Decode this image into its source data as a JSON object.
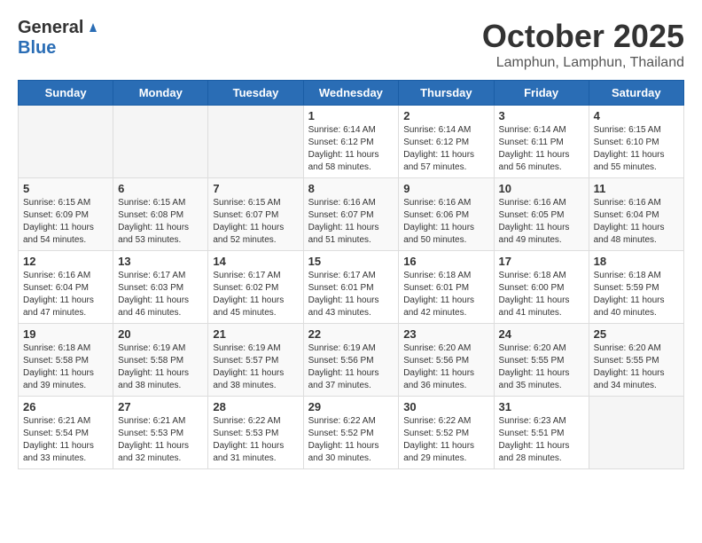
{
  "header": {
    "logo_general": "General",
    "logo_blue": "Blue",
    "month": "October 2025",
    "location": "Lamphun, Lamphun, Thailand"
  },
  "weekdays": [
    "Sunday",
    "Monday",
    "Tuesday",
    "Wednesday",
    "Thursday",
    "Friday",
    "Saturday"
  ],
  "weeks": [
    [
      {
        "day": "",
        "info": ""
      },
      {
        "day": "",
        "info": ""
      },
      {
        "day": "",
        "info": ""
      },
      {
        "day": "1",
        "info": "Sunrise: 6:14 AM\nSunset: 6:12 PM\nDaylight: 11 hours\nand 58 minutes."
      },
      {
        "day": "2",
        "info": "Sunrise: 6:14 AM\nSunset: 6:12 PM\nDaylight: 11 hours\nand 57 minutes."
      },
      {
        "day": "3",
        "info": "Sunrise: 6:14 AM\nSunset: 6:11 PM\nDaylight: 11 hours\nand 56 minutes."
      },
      {
        "day": "4",
        "info": "Sunrise: 6:15 AM\nSunset: 6:10 PM\nDaylight: 11 hours\nand 55 minutes."
      }
    ],
    [
      {
        "day": "5",
        "info": "Sunrise: 6:15 AM\nSunset: 6:09 PM\nDaylight: 11 hours\nand 54 minutes."
      },
      {
        "day": "6",
        "info": "Sunrise: 6:15 AM\nSunset: 6:08 PM\nDaylight: 11 hours\nand 53 minutes."
      },
      {
        "day": "7",
        "info": "Sunrise: 6:15 AM\nSunset: 6:07 PM\nDaylight: 11 hours\nand 52 minutes."
      },
      {
        "day": "8",
        "info": "Sunrise: 6:16 AM\nSunset: 6:07 PM\nDaylight: 11 hours\nand 51 minutes."
      },
      {
        "day": "9",
        "info": "Sunrise: 6:16 AM\nSunset: 6:06 PM\nDaylight: 11 hours\nand 50 minutes."
      },
      {
        "day": "10",
        "info": "Sunrise: 6:16 AM\nSunset: 6:05 PM\nDaylight: 11 hours\nand 49 minutes."
      },
      {
        "day": "11",
        "info": "Sunrise: 6:16 AM\nSunset: 6:04 PM\nDaylight: 11 hours\nand 48 minutes."
      }
    ],
    [
      {
        "day": "12",
        "info": "Sunrise: 6:16 AM\nSunset: 6:04 PM\nDaylight: 11 hours\nand 47 minutes."
      },
      {
        "day": "13",
        "info": "Sunrise: 6:17 AM\nSunset: 6:03 PM\nDaylight: 11 hours\nand 46 minutes."
      },
      {
        "day": "14",
        "info": "Sunrise: 6:17 AM\nSunset: 6:02 PM\nDaylight: 11 hours\nand 45 minutes."
      },
      {
        "day": "15",
        "info": "Sunrise: 6:17 AM\nSunset: 6:01 PM\nDaylight: 11 hours\nand 43 minutes."
      },
      {
        "day": "16",
        "info": "Sunrise: 6:18 AM\nSunset: 6:01 PM\nDaylight: 11 hours\nand 42 minutes."
      },
      {
        "day": "17",
        "info": "Sunrise: 6:18 AM\nSunset: 6:00 PM\nDaylight: 11 hours\nand 41 minutes."
      },
      {
        "day": "18",
        "info": "Sunrise: 6:18 AM\nSunset: 5:59 PM\nDaylight: 11 hours\nand 40 minutes."
      }
    ],
    [
      {
        "day": "19",
        "info": "Sunrise: 6:18 AM\nSunset: 5:58 PM\nDaylight: 11 hours\nand 39 minutes."
      },
      {
        "day": "20",
        "info": "Sunrise: 6:19 AM\nSunset: 5:58 PM\nDaylight: 11 hours\nand 38 minutes."
      },
      {
        "day": "21",
        "info": "Sunrise: 6:19 AM\nSunset: 5:57 PM\nDaylight: 11 hours\nand 38 minutes."
      },
      {
        "day": "22",
        "info": "Sunrise: 6:19 AM\nSunset: 5:56 PM\nDaylight: 11 hours\nand 37 minutes."
      },
      {
        "day": "23",
        "info": "Sunrise: 6:20 AM\nSunset: 5:56 PM\nDaylight: 11 hours\nand 36 minutes."
      },
      {
        "day": "24",
        "info": "Sunrise: 6:20 AM\nSunset: 5:55 PM\nDaylight: 11 hours\nand 35 minutes."
      },
      {
        "day": "25",
        "info": "Sunrise: 6:20 AM\nSunset: 5:55 PM\nDaylight: 11 hours\nand 34 minutes."
      }
    ],
    [
      {
        "day": "26",
        "info": "Sunrise: 6:21 AM\nSunset: 5:54 PM\nDaylight: 11 hours\nand 33 minutes."
      },
      {
        "day": "27",
        "info": "Sunrise: 6:21 AM\nSunset: 5:53 PM\nDaylight: 11 hours\nand 32 minutes."
      },
      {
        "day": "28",
        "info": "Sunrise: 6:22 AM\nSunset: 5:53 PM\nDaylight: 11 hours\nand 31 minutes."
      },
      {
        "day": "29",
        "info": "Sunrise: 6:22 AM\nSunset: 5:52 PM\nDaylight: 11 hours\nand 30 minutes."
      },
      {
        "day": "30",
        "info": "Sunrise: 6:22 AM\nSunset: 5:52 PM\nDaylight: 11 hours\nand 29 minutes."
      },
      {
        "day": "31",
        "info": "Sunrise: 6:23 AM\nSunset: 5:51 PM\nDaylight: 11 hours\nand 28 minutes."
      },
      {
        "day": "",
        "info": ""
      }
    ]
  ]
}
